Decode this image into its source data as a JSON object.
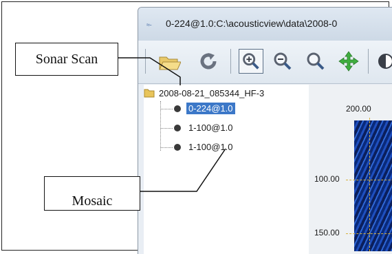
{
  "window": {
    "title": "0-224@1.0:C:\\acousticview\\data\\2008-0",
    "app_icon": "app-wave-icon"
  },
  "toolbar": {
    "buttons": [
      {
        "icon": "folder-open-icon"
      },
      {
        "icon": "refresh-icon"
      },
      {
        "icon": "zoom-in-icon",
        "pressed": true
      },
      {
        "icon": "zoom-out-icon"
      },
      {
        "icon": "magnify-icon"
      },
      {
        "icon": "pan-arrows-icon"
      }
    ]
  },
  "tree": {
    "root": {
      "label": "2008-08-21_085344_HF-3",
      "icon": "folder-icon"
    },
    "items": [
      {
        "label": "0-224@1.0",
        "selected": true
      },
      {
        "label": "1-100@1.0",
        "selected": false
      },
      {
        "label": "1-100@1.0",
        "selected": false
      }
    ]
  },
  "view": {
    "x_ticks": [
      "200.00"
    ],
    "y_ticks": [
      "100.00",
      "150.00"
    ]
  },
  "callouts": {
    "sonar_scan": "Sonar Scan",
    "mosaic": "Mosaic"
  }
}
